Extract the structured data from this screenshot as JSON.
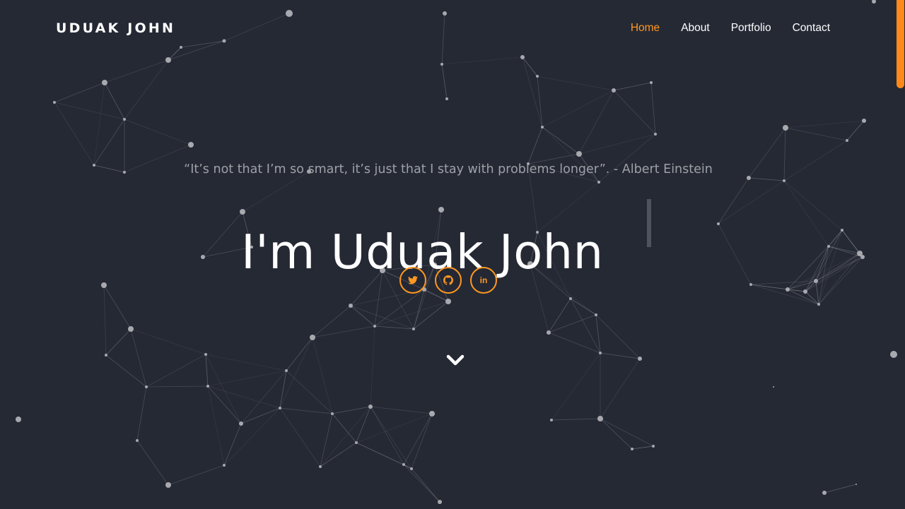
{
  "brand": {
    "name": "UDUAK JOHN"
  },
  "nav": {
    "items": [
      {
        "label": "Home",
        "active": true
      },
      {
        "label": "About",
        "active": false
      },
      {
        "label": "Portfolio",
        "active": false
      },
      {
        "label": "Contact",
        "active": false
      }
    ]
  },
  "hero": {
    "quote": "“It’s not that I’m so smart, it’s just that I stay with problems longer”. - Albert Einstein",
    "heading": "I'm Uduak John"
  },
  "social": {
    "links": [
      {
        "name": "twitter",
        "icon": "twitter-icon"
      },
      {
        "name": "github",
        "icon": "github-icon"
      },
      {
        "name": "linkedin",
        "icon": "linkedin-icon",
        "glyph": "in"
      }
    ]
  },
  "scroll": {
    "icon": "chevron-down-icon"
  },
  "colors": {
    "background": "#252934",
    "accent": "#ff9820",
    "text": "#ffffff",
    "quote": "#9ea0a6",
    "network": "#8e9099"
  }
}
